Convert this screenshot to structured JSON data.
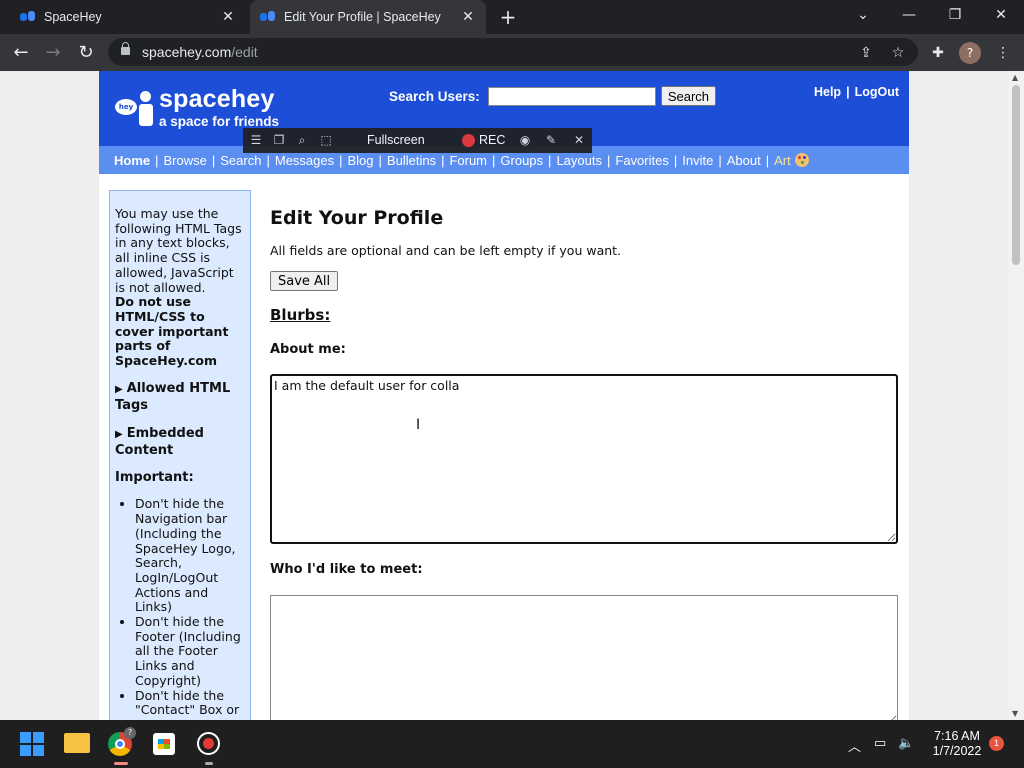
{
  "browser": {
    "tabs": [
      {
        "title": "SpaceHey"
      },
      {
        "title": "Edit Your Profile | SpaceHey"
      }
    ],
    "url_domain": "spacehey.com",
    "url_path": "/edit",
    "profile_initial": "?"
  },
  "header": {
    "brand": "spacehey",
    "tagline": "a space for friends",
    "bubble_text": "hey",
    "search_label": "Search Users:",
    "search_placeholder": "",
    "search_button": "Search",
    "help": "Help",
    "logout": "LogOut"
  },
  "nav": {
    "items": [
      "Home",
      "Browse",
      "Search",
      "Messages",
      "Blog",
      "Bulletins",
      "Forum",
      "Groups",
      "Layouts",
      "Favorites",
      "Invite",
      "About",
      "Art"
    ]
  },
  "recording_toolbar": {
    "fullscreen": "Fullscreen",
    "rec": "REC"
  },
  "sidebar": {
    "intro": "You may use the following HTML Tags in any text blocks, all inline CSS is allowed, JavaScript is not allowed.",
    "warning": "Do not use HTML/CSS to cover important parts of SpaceHey.com",
    "allowed_tags": "Allowed HTML Tags",
    "embedded": "Embedded Content",
    "important": "Important:",
    "rules": [
      "Don't hide the Navigation bar (Including the SpaceHey Logo, Search, LogIn/LogOut Actions and Links)",
      "Don't hide the Footer (Including all the Footer Links and Copyright)",
      "Don't hide the \"Contact\" Box or"
    ]
  },
  "main": {
    "title": "Edit Your Profile",
    "hint": "All fields are optional and can be left empty if you want.",
    "save_all": "Save All",
    "blurbs": "Blurbs:",
    "about_label": "About me:",
    "about_value": "I am the default user for colla",
    "meet_label": "Who I'd like to meet:",
    "meet_value": ""
  },
  "taskbar": {
    "time": "7:16 AM",
    "date": "1/7/2022",
    "notifications": "1",
    "chrome_badge": "?"
  },
  "colors": {
    "header_blue": "#1d4ed8",
    "nav_blue": "#5a8ef0",
    "sidebar_bg": "#dbeafe",
    "rec_red": "#e53935"
  },
  "icons": [
    "spacehey-favicon",
    "close-icon",
    "plus-icon",
    "minimize-icon",
    "restore-icon",
    "window-close-icon",
    "back-icon",
    "forward-icon",
    "reload-icon",
    "lock-icon",
    "share-icon",
    "star-icon",
    "extensions-icon",
    "menu-dots-icon",
    "windows-start-icon",
    "file-explorer-icon",
    "chrome-icon",
    "store-icon",
    "recorder-icon"
  ]
}
